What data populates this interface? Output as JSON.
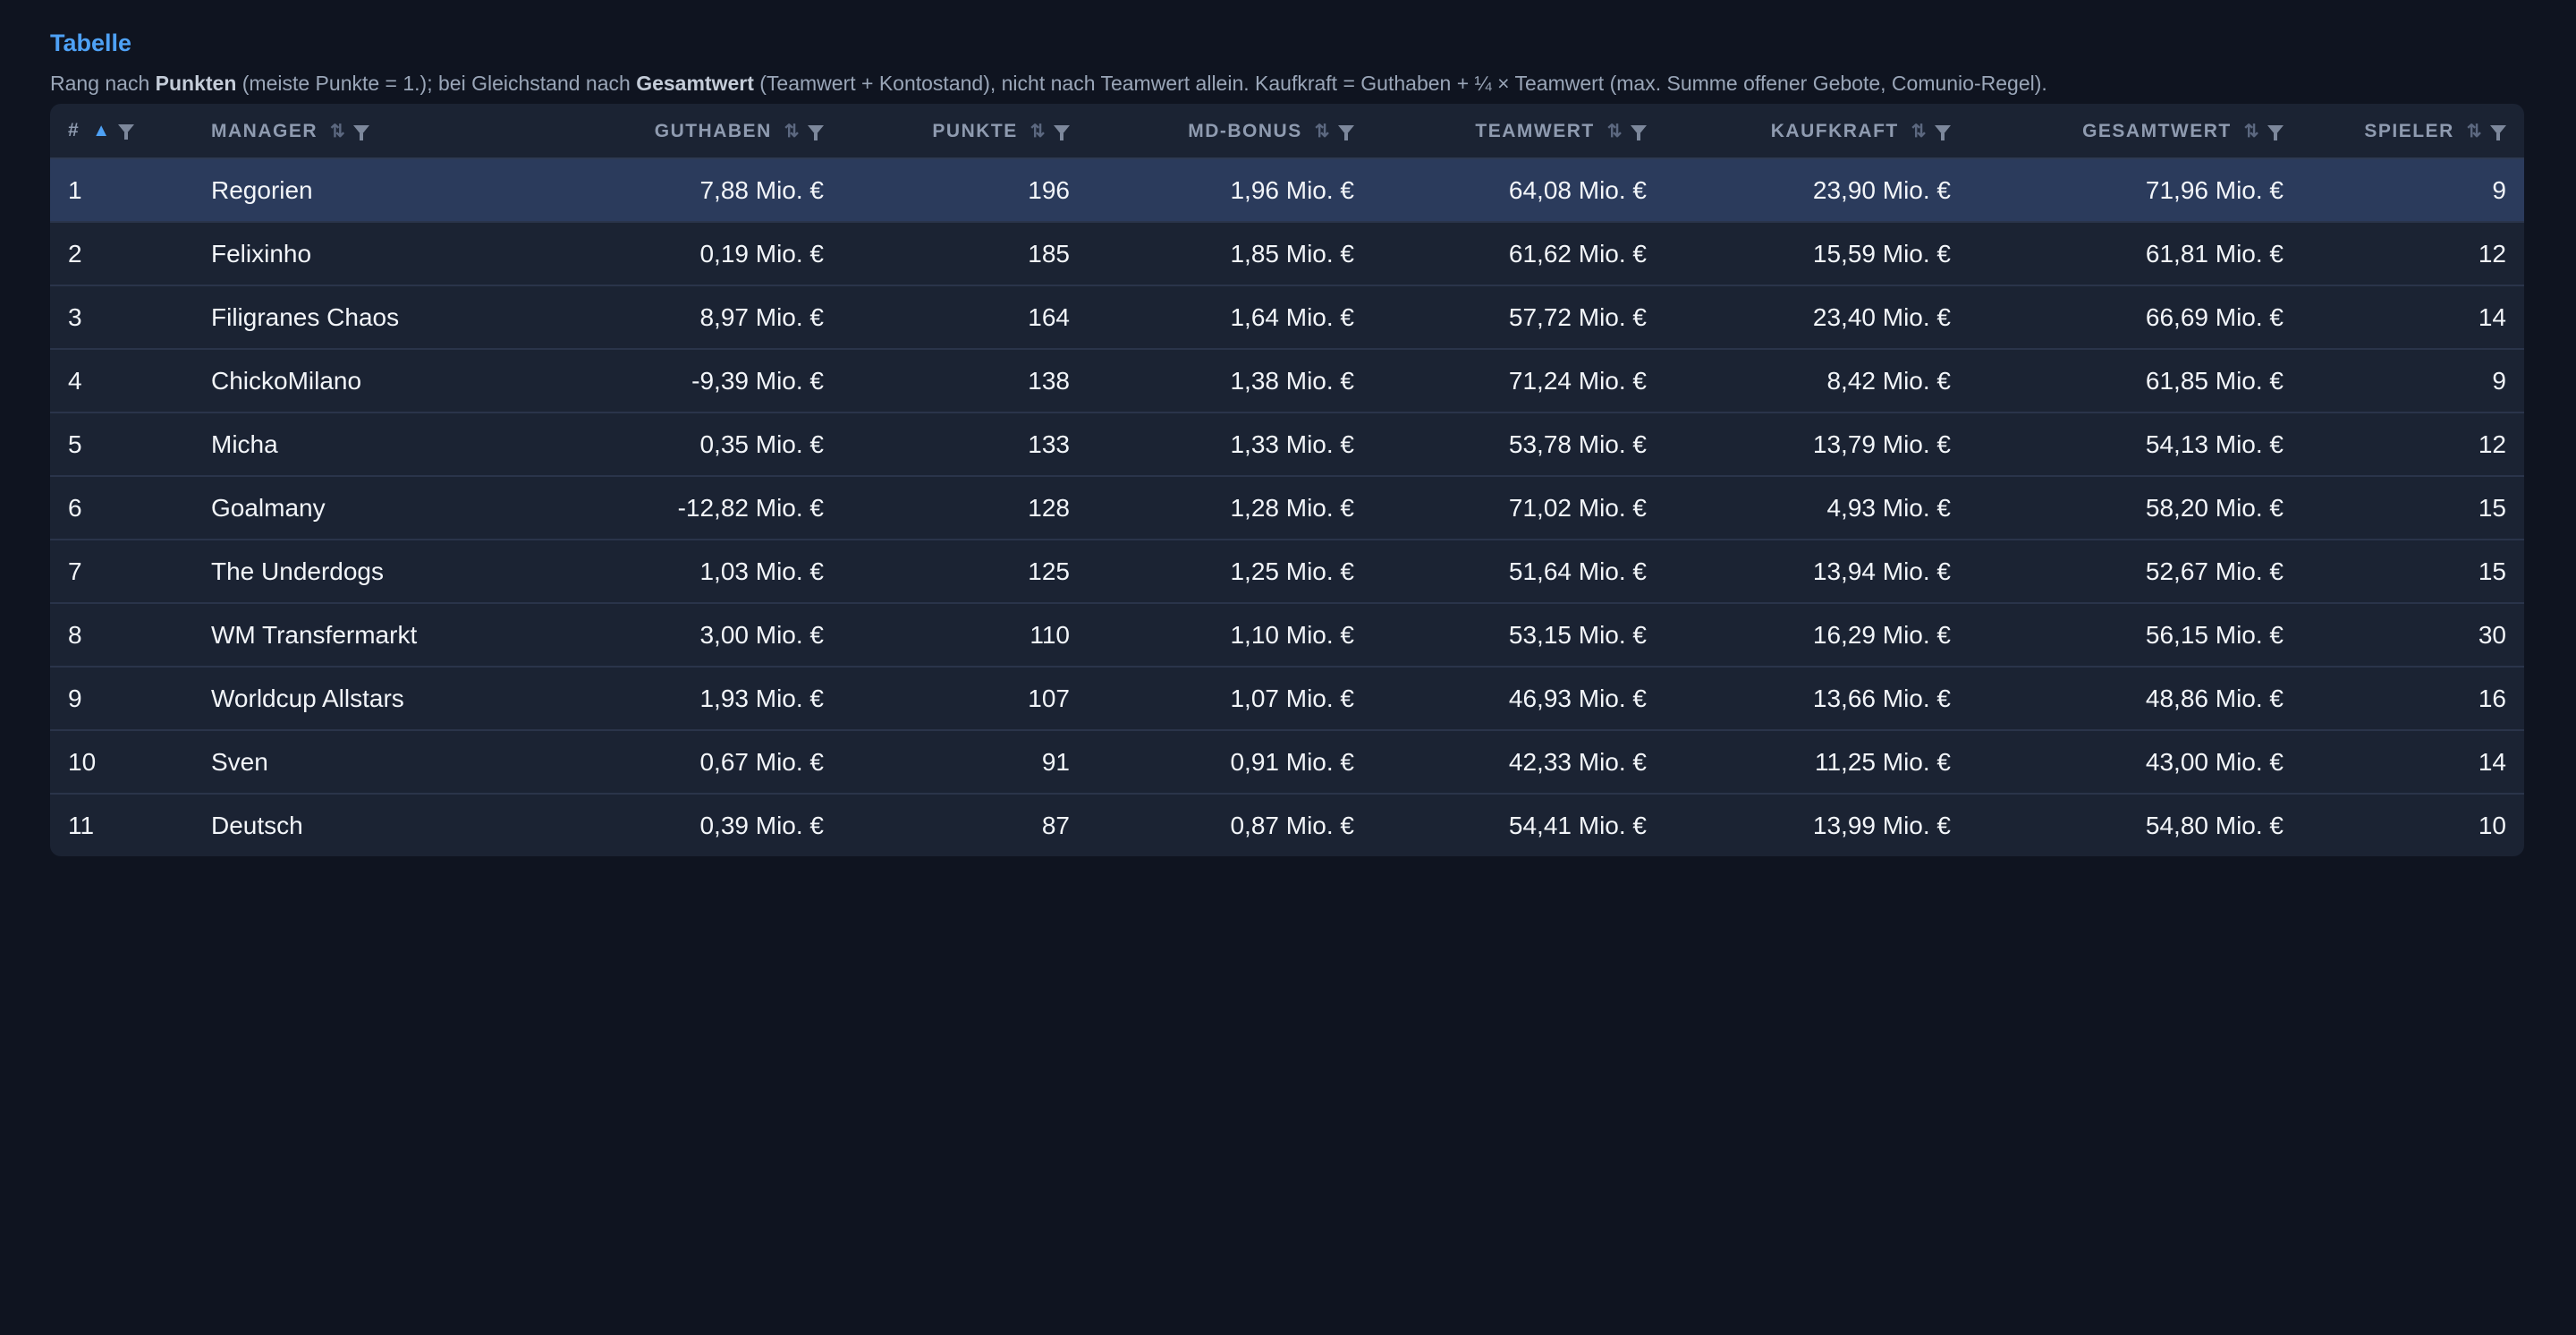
{
  "section": {
    "title": "Tabelle",
    "desc": {
      "t1": "Rang nach ",
      "b1": "Punkten",
      "t2": " (meiste Punkte = 1.); bei Gleichstand nach ",
      "b2": "Gesamtwert",
      "t3": " (Teamwert + Kontostand), nicht nach Teamwert allein. Kaufkraft = Guthaben + ¼ × Teamwert (max. Summe offener Gebote, Comunio-Regel)."
    }
  },
  "table": {
    "headers": {
      "rank": "#",
      "manager": "MANAGER",
      "guthaben": "GUTHABEN",
      "punkte": "PUNKTE",
      "mdbonus": "MD-BONUS",
      "teamwert": "TEAMWERT",
      "kaufkraft": "KAUFKRAFT",
      "gesamtwert": "GESAMTWERT",
      "spieler": "SPIELER"
    },
    "icons": {
      "sort_active": "sort-ascending-icon",
      "sort": "sort-icon",
      "filter": "filter-icon"
    },
    "colors": {
      "accent": "#4ea1f5",
      "highlight_row": "#2b3b5c",
      "background": "#0f1420",
      "table_bg": "#1b2333"
    },
    "rows": [
      {
        "rank": "1",
        "manager": "Regorien",
        "guthaben": "7,88 Mio. €",
        "punkte": "196",
        "mdbonus": "1,96 Mio. €",
        "teamwert": "64,08 Mio. €",
        "kaufkraft": "23,90 Mio. €",
        "gesamtwert": "71,96 Mio. €",
        "spieler": "9"
      },
      {
        "rank": "2",
        "manager": "Felixinho",
        "guthaben": "0,19 Mio. €",
        "punkte": "185",
        "mdbonus": "1,85 Mio. €",
        "teamwert": "61,62 Mio. €",
        "kaufkraft": "15,59 Mio. €",
        "gesamtwert": "61,81 Mio. €",
        "spieler": "12"
      },
      {
        "rank": "3",
        "manager": "Filigranes Chaos",
        "guthaben": "8,97 Mio. €",
        "punkte": "164",
        "mdbonus": "1,64 Mio. €",
        "teamwert": "57,72 Mio. €",
        "kaufkraft": "23,40 Mio. €",
        "gesamtwert": "66,69 Mio. €",
        "spieler": "14"
      },
      {
        "rank": "4",
        "manager": "ChickoMilano",
        "guthaben": "-9,39 Mio. €",
        "punkte": "138",
        "mdbonus": "1,38 Mio. €",
        "teamwert": "71,24 Mio. €",
        "kaufkraft": "8,42 Mio. €",
        "gesamtwert": "61,85 Mio. €",
        "spieler": "9"
      },
      {
        "rank": "5",
        "manager": "Micha",
        "guthaben": "0,35 Mio. €",
        "punkte": "133",
        "mdbonus": "1,33 Mio. €",
        "teamwert": "53,78 Mio. €",
        "kaufkraft": "13,79 Mio. €",
        "gesamtwert": "54,13 Mio. €",
        "spieler": "12"
      },
      {
        "rank": "6",
        "manager": "Goalmany",
        "guthaben": "-12,82 Mio. €",
        "punkte": "128",
        "mdbonus": "1,28 Mio. €",
        "teamwert": "71,02 Mio. €",
        "kaufkraft": "4,93 Mio. €",
        "gesamtwert": "58,20 Mio. €",
        "spieler": "15"
      },
      {
        "rank": "7",
        "manager": "The Underdogs",
        "guthaben": "1,03 Mio. €",
        "punkte": "125",
        "mdbonus": "1,25 Mio. €",
        "teamwert": "51,64 Mio. €",
        "kaufkraft": "13,94 Mio. €",
        "gesamtwert": "52,67 Mio. €",
        "spieler": "15"
      },
      {
        "rank": "8",
        "manager": "WM Transfermarkt",
        "guthaben": "3,00 Mio. €",
        "punkte": "110",
        "mdbonus": "1,10 Mio. €",
        "teamwert": "53,15 Mio. €",
        "kaufkraft": "16,29 Mio. €",
        "gesamtwert": "56,15 Mio. €",
        "spieler": "30"
      },
      {
        "rank": "9",
        "manager": "Worldcup Allstars",
        "guthaben": "1,93 Mio. €",
        "punkte": "107",
        "mdbonus": "1,07 Mio. €",
        "teamwert": "46,93 Mio. €",
        "kaufkraft": "13,66 Mio. €",
        "gesamtwert": "48,86 Mio. €",
        "spieler": "16"
      },
      {
        "rank": "10",
        "manager": "Sven",
        "guthaben": "0,67 Mio. €",
        "punkte": "91",
        "mdbonus": "0,91 Mio. €",
        "teamwert": "42,33 Mio. €",
        "kaufkraft": "11,25 Mio. €",
        "gesamtwert": "43,00 Mio. €",
        "spieler": "14"
      },
      {
        "rank": "11",
        "manager": "Deutsch",
        "guthaben": "0,39 Mio. €",
        "punkte": "87",
        "mdbonus": "0,87 Mio. €",
        "teamwert": "54,41 Mio. €",
        "kaufkraft": "13,99 Mio. €",
        "gesamtwert": "54,80 Mio. €",
        "spieler": "10"
      }
    ]
  }
}
